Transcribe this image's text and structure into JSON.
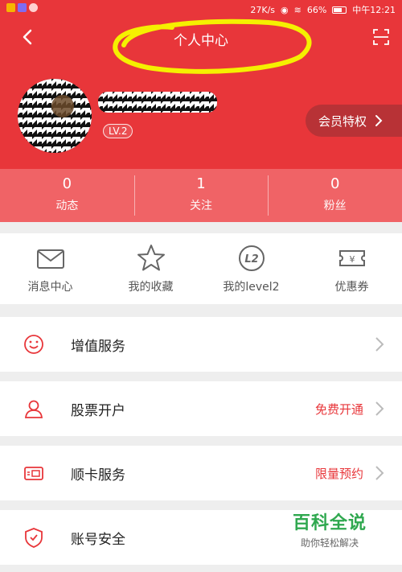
{
  "status_bar": {
    "net_speed": "27K/s",
    "battery": "66%",
    "time": "中午12:21"
  },
  "header": {
    "title": "个人中心",
    "level": "LV.2",
    "vip_label": "会员特权"
  },
  "stats": [
    {
      "value": "0",
      "label": "动态"
    },
    {
      "value": "1",
      "label": "关注"
    },
    {
      "value": "0",
      "label": "粉丝"
    }
  ],
  "shortcuts": [
    {
      "label": "消息中心",
      "icon": "mail-icon"
    },
    {
      "label": "我的收藏",
      "icon": "star-icon"
    },
    {
      "label": "我的level2",
      "icon": "level2-icon",
      "badge": "L2"
    },
    {
      "label": "优惠券",
      "icon": "coupon-icon",
      "badge": "¥"
    }
  ],
  "rows": [
    {
      "label": "增值服务",
      "icon": "smile-icon",
      "note": ""
    },
    {
      "label": "股票开户",
      "icon": "user-icon",
      "note": "免费开通"
    },
    {
      "label": "顺卡服务",
      "icon": "card-icon",
      "note": "限量预约"
    },
    {
      "label": "账号安全",
      "icon": "shield-icon",
      "note": ""
    }
  ],
  "watermark": {
    "title": "百科全说",
    "subtitle": "助你轻松解决"
  },
  "colors": {
    "brand_red": "#e8363a",
    "stats_bg": "#f06366",
    "vip_bg": "#b83236",
    "highlight": "#f5f000"
  }
}
